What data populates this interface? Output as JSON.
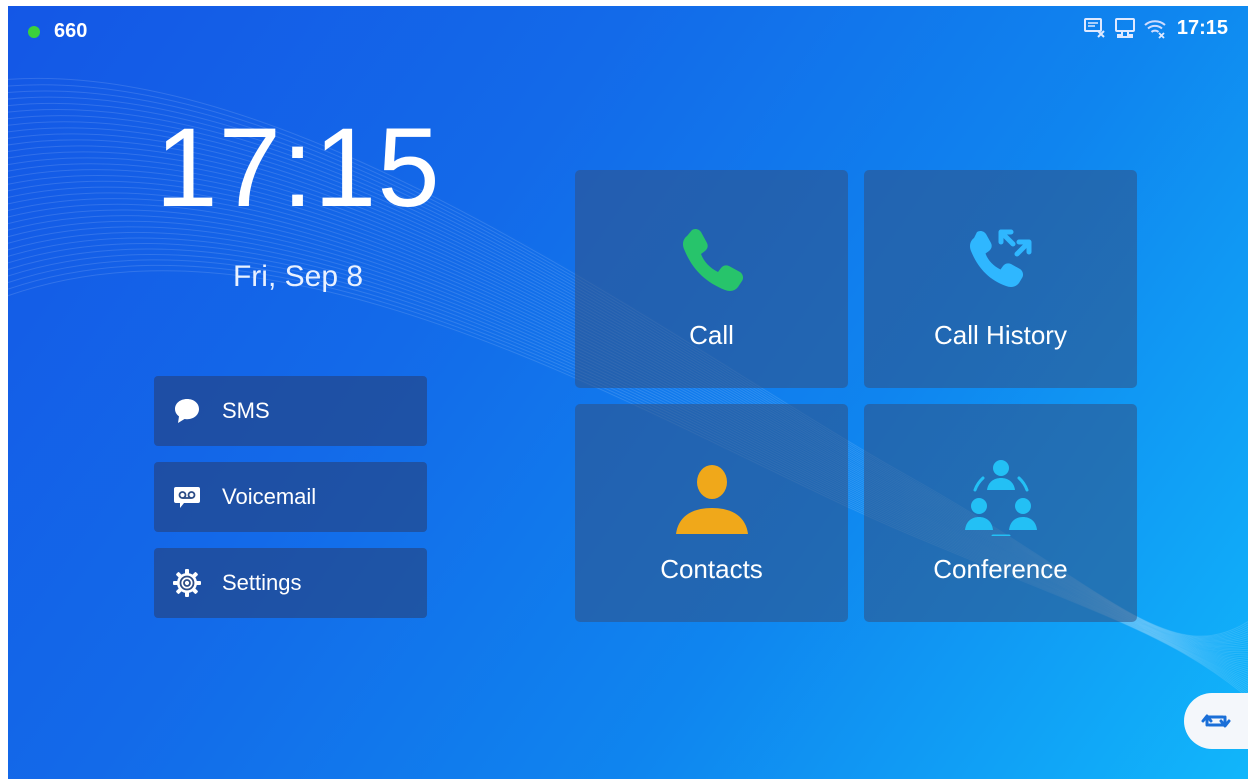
{
  "status_bar": {
    "account": "660",
    "time": "17:15",
    "icons": [
      "network-disconnected-icon",
      "ethernet-icon",
      "wifi-off-icon"
    ],
    "online_color": "#3bd13b"
  },
  "clock": {
    "time": "17:15",
    "date": "Fri, Sep 8"
  },
  "side_menu": {
    "items": [
      {
        "label": "SMS",
        "icon": "sms-bubble-icon"
      },
      {
        "label": "Voicemail",
        "icon": "voicemail-icon"
      },
      {
        "label": "Settings",
        "icon": "gear-icon"
      }
    ]
  },
  "tiles": {
    "items": [
      {
        "label": "Call",
        "icon": "phone-icon",
        "color": "#27c46b"
      },
      {
        "label": "Call History",
        "icon": "call-history-icon",
        "color": "#2fb7ff"
      },
      {
        "label": "Contacts",
        "icon": "contact-person-icon",
        "color": "#f0a81a"
      },
      {
        "label": "Conference",
        "icon": "conference-icon",
        "color": "#23c0f5"
      }
    ]
  },
  "switch_button": {
    "icon": "swap-icon",
    "color": "#1a6fd8"
  }
}
